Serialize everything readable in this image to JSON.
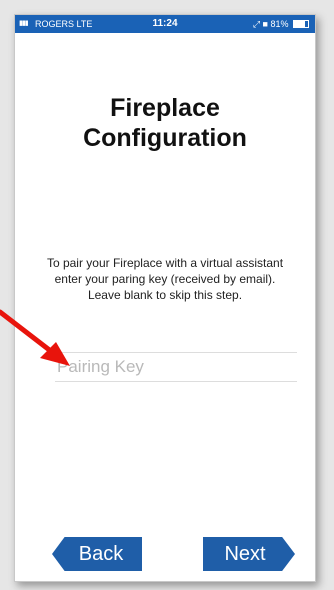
{
  "status_bar": {
    "signal": "▮▮▮",
    "carrier": "ROGERS  LTE",
    "time": "11:24",
    "right": "⤢ ■ 81%"
  },
  "screen": {
    "title_line1": "Fireplace",
    "title_line2": "Configuration",
    "instructions": "To pair your Fireplace with a virtual assistant enter your paring key (received by email). Leave blank to skip this step.",
    "pairing_key_value": "",
    "pairing_key_placeholder": "Pairing Key"
  },
  "buttons": {
    "back_label": "Back",
    "next_label": "Next"
  },
  "annotation": {
    "arrow_color": "#e8140c"
  },
  "colors": {
    "status_bar": "#1a62b6",
    "button": "#1f5ea8"
  }
}
